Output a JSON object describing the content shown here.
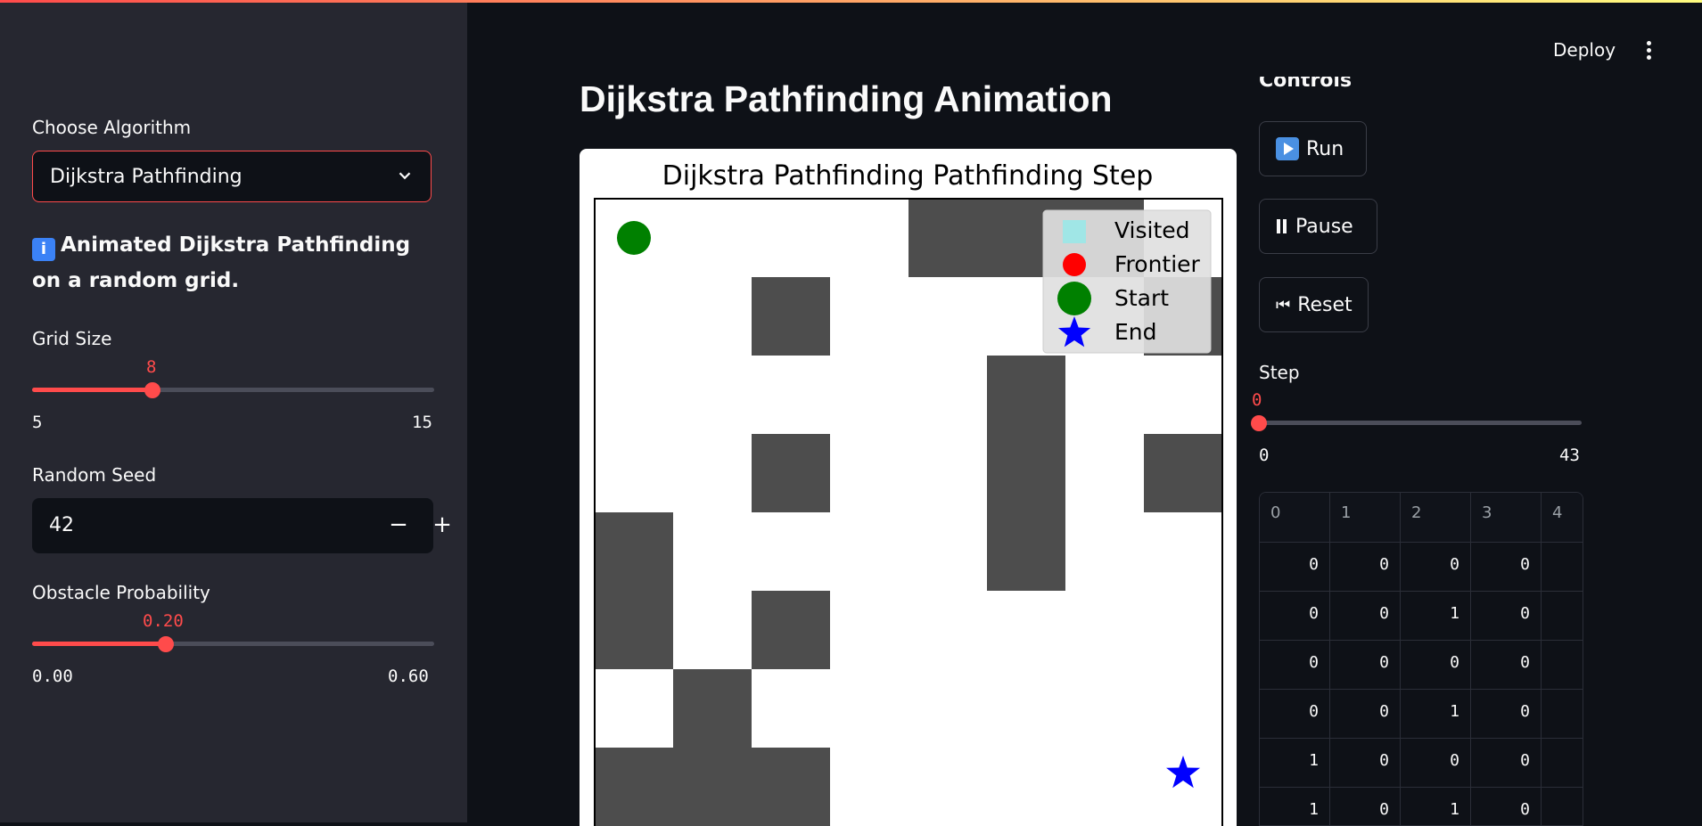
{
  "sidebar": {
    "algorithm_label": "Choose Algorithm",
    "algorithm_value": "Dijkstra Pathfinding",
    "info_icon": "info-icon",
    "info_text": "Animated Dijkstra Pathfinding on a random grid.",
    "grid_size": {
      "label": "Grid Size",
      "value": "8",
      "min": "5",
      "max": "15",
      "fraction": 0.3
    },
    "seed": {
      "label": "Random Seed",
      "value": "42",
      "minus": "−",
      "plus": "+"
    },
    "obstacle": {
      "label": "Obstacle Probability",
      "value": "0.20",
      "min": "0.00",
      "max": "0.60",
      "fraction": 0.3333
    }
  },
  "header": {
    "deploy_label": "Deploy",
    "menu_icon": "kebab-menu-icon"
  },
  "main": {
    "title": "Dijkstra Pathfinding Animation"
  },
  "controls": {
    "heading": "Controls",
    "run_label": "Run",
    "pause_label": "Pause",
    "reset_label": "Reset",
    "reset_glyph": "⏮",
    "step": {
      "label": "Step",
      "value": "0",
      "min": "0",
      "max": "43",
      "fraction": 0
    }
  },
  "plot": {
    "title": "Dijkstra Pathfinding Pathfinding Step",
    "legend": [
      "Visited",
      "Frontier",
      "Start",
      "End"
    ],
    "colors": {
      "obstacle": "#4d4d4d",
      "visited": "#a0e6e6",
      "frontier": "#ff0000",
      "start": "#008000",
      "end": "#0000ff"
    },
    "grid_rows": 8,
    "grid_cols": 8,
    "obstacles": [
      [
        0,
        4
      ],
      [
        0,
        5
      ],
      [
        0,
        6
      ],
      [
        1,
        2
      ],
      [
        1,
        7
      ],
      [
        2,
        5
      ],
      [
        3,
        2
      ],
      [
        3,
        5
      ],
      [
        3,
        7
      ],
      [
        4,
        0
      ],
      [
        4,
        5
      ],
      [
        5,
        0
      ],
      [
        5,
        2
      ],
      [
        6,
        1
      ],
      [
        7,
        0
      ],
      [
        7,
        1
      ],
      [
        7,
        2
      ]
    ],
    "start": [
      0,
      0
    ],
    "end": [
      7,
      7
    ]
  },
  "table": {
    "headers": [
      "0",
      "1",
      "2",
      "3",
      "4"
    ],
    "rows": [
      [
        "0",
        "0",
        "0",
        "0",
        ""
      ],
      [
        "0",
        "0",
        "1",
        "0",
        ""
      ],
      [
        "0",
        "0",
        "0",
        "0",
        ""
      ],
      [
        "0",
        "0",
        "1",
        "0",
        ""
      ],
      [
        "1",
        "0",
        "0",
        "0",
        ""
      ],
      [
        "1",
        "0",
        "1",
        "0",
        ""
      ]
    ]
  }
}
